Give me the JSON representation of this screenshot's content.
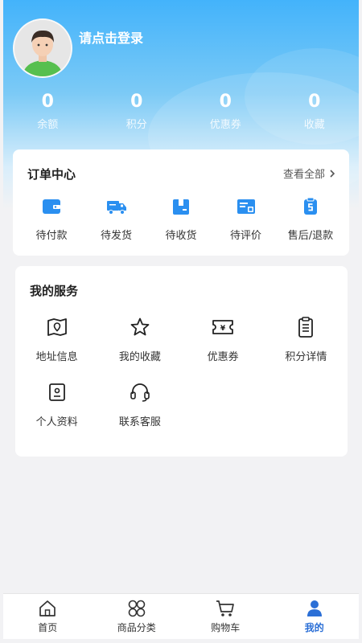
{
  "profile": {
    "login_prompt": "请点击登录"
  },
  "stats": [
    {
      "value": "0",
      "label": "余额"
    },
    {
      "value": "0",
      "label": "积分"
    },
    {
      "value": "0",
      "label": "优惠券"
    },
    {
      "value": "0",
      "label": "收藏"
    }
  ],
  "orders": {
    "title": "订单中心",
    "view_all": "查看全部",
    "items": [
      {
        "label": "待付款",
        "icon": "wallet-icon"
      },
      {
        "label": "待发货",
        "icon": "truck-icon"
      },
      {
        "label": "待收货",
        "icon": "box-icon"
      },
      {
        "label": "待评价",
        "icon": "review-icon"
      },
      {
        "label": "售后/退款",
        "icon": "refund-icon"
      }
    ]
  },
  "services": {
    "title": "我的服务",
    "items": [
      {
        "label": "地址信息",
        "icon": "map-icon"
      },
      {
        "label": "我的收藏",
        "icon": "star-icon"
      },
      {
        "label": "优惠券",
        "icon": "coupon-icon"
      },
      {
        "label": "积分详情",
        "icon": "clipboard-icon"
      },
      {
        "label": "个人资料",
        "icon": "profile-card-icon"
      },
      {
        "label": "联系客服",
        "icon": "headset-icon"
      }
    ]
  },
  "tabbar": {
    "items": [
      {
        "label": "首页",
        "icon": "home-icon"
      },
      {
        "label": "商品分类",
        "icon": "category-icon"
      },
      {
        "label": "购物车",
        "icon": "cart-icon"
      },
      {
        "label": "我的",
        "icon": "user-icon"
      }
    ],
    "active_index": 3
  },
  "colors": {
    "accent": "#2b6fd6",
    "icon_blue": "#2a8ff0",
    "hero_top": "#43b3fb"
  }
}
